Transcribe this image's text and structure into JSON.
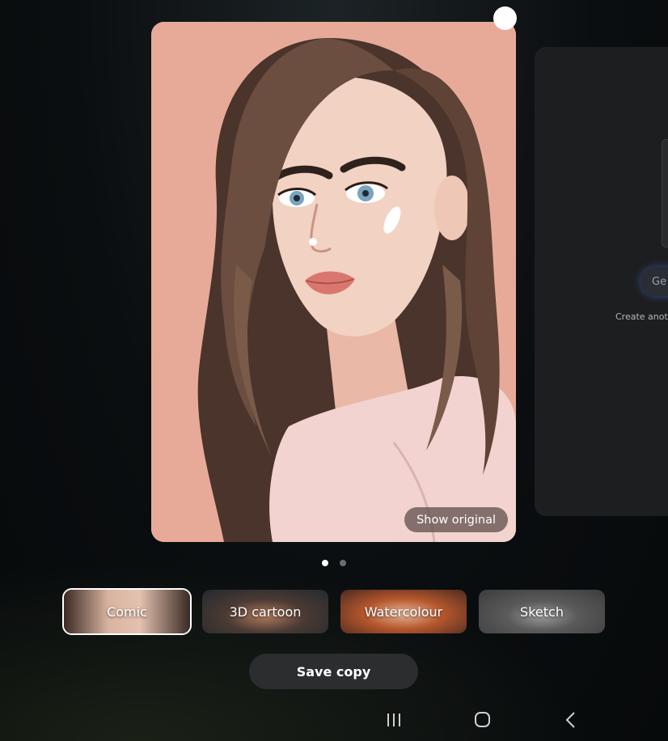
{
  "viewer": {
    "show_original_label": "Show original",
    "side_card": {
      "generate_label": "Ge",
      "caption": "Create anot"
    }
  },
  "pager": {
    "total": 2,
    "current": 1
  },
  "styles": [
    {
      "label": "Comic",
      "selected": true
    },
    {
      "label": "3D cartoon",
      "selected": false
    },
    {
      "label": "Watercolour",
      "selected": false
    },
    {
      "label": "Sketch",
      "selected": false
    }
  ],
  "actions": {
    "save_copy_label": "Save copy"
  },
  "navbar": {
    "recents_icon": "recents-icon",
    "home_icon": "home-icon",
    "back_icon": "back-icon"
  },
  "colors": {
    "card_background": "#e8aa98",
    "hair": "#5a4236",
    "skin": "#f2d2c2",
    "lips": "#d9776e",
    "shirt": "#f2d3cf",
    "selected_border": "#ffffff",
    "button_bg": "#2b2d2f"
  }
}
